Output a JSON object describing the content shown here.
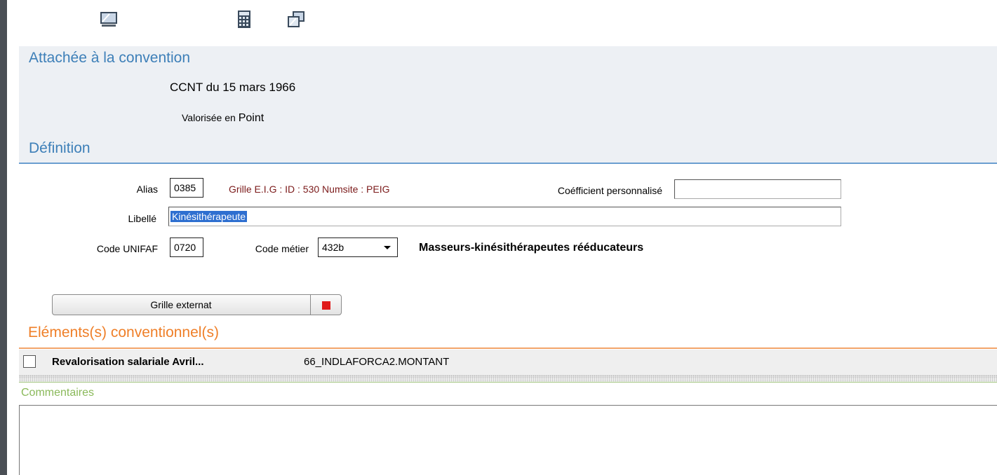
{
  "toolbar": {
    "icons": [
      "monitor-icon",
      "calculator-icon",
      "windows-icon"
    ]
  },
  "attachee": {
    "title": "Attachée à la convention",
    "convention": "CCNT du 15 mars 1966",
    "valorisee_prefix": "Valorisée en",
    "valorisee_value": "Point"
  },
  "definition": {
    "title": "Définition",
    "alias_label": "Alias",
    "alias_value": "0385",
    "grille_info": "Grille E.I.G : ID : 530 Numsite : PEIG",
    "coef_label": "Coéfficient personnalisé",
    "coef_value": "",
    "libelle_label": "Libellé",
    "libelle_value": "Kinésithérapeute",
    "unifaf_label": "Code UNIFAF",
    "unifaf_value": "0720",
    "metier_label": "Code métier",
    "metier_value": "432b",
    "metier_desc": "Masseurs-kinésithérapeutes rééducateurs"
  },
  "grille_button": {
    "label": "Grille externat",
    "status_color": "#e01b1b"
  },
  "elements": {
    "title": "Eléments(s) conventionnel(s)",
    "rows": [
      {
        "label": "Revalorisation salariale Avril...",
        "code": "66_INDLAFORCA2.MONTANT",
        "checked": false
      }
    ]
  },
  "commentaires": {
    "title": "Commentaires",
    "value": ""
  },
  "colors": {
    "section_blue": "#3d7fb8",
    "section_orange": "#ef7f28",
    "section_green": "#8ab95a",
    "grille_info": "#7b1a1a"
  }
}
